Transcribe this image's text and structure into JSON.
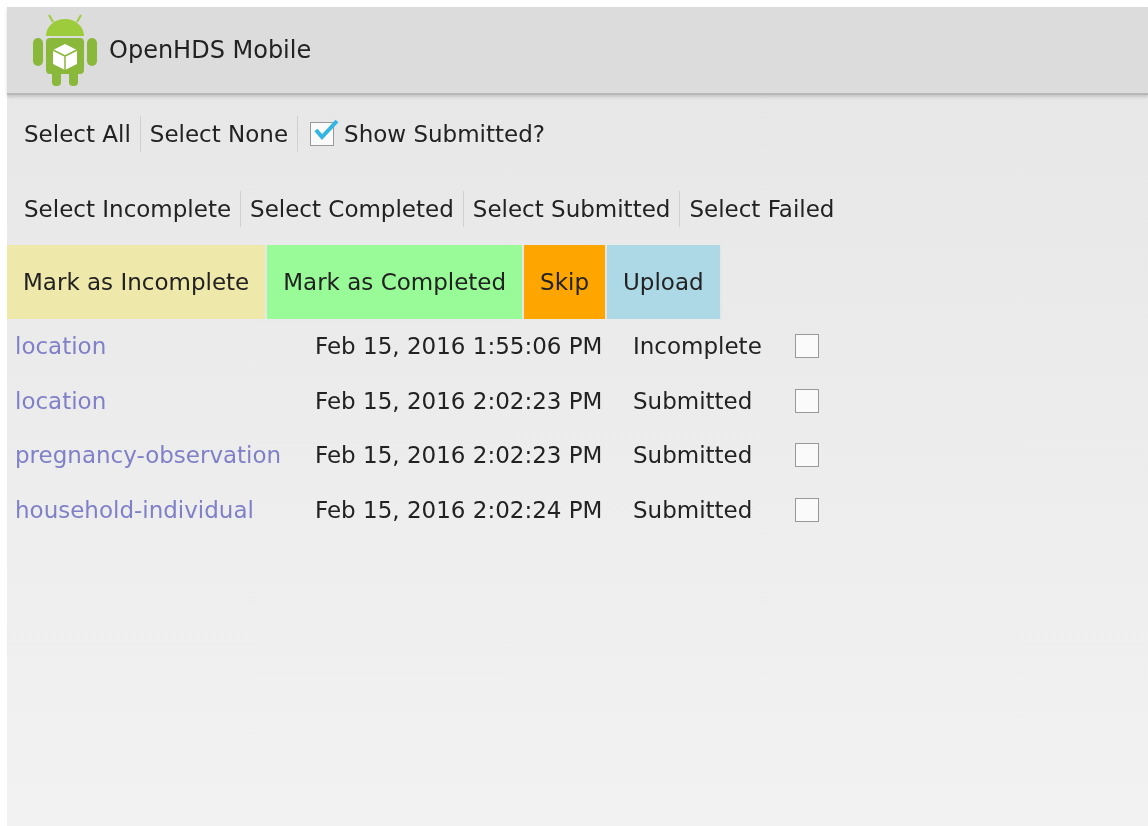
{
  "action_bar": {
    "title": "OpenHDS Mobile"
  },
  "toolbar_1": {
    "buttons": [
      "Select All",
      "Select None"
    ],
    "show_submitted": {
      "label": "Show Submitted?",
      "checked": true
    }
  },
  "toolbar_2": {
    "buttons": [
      "Select Incomplete",
      "Select Completed",
      "Select Submitted",
      "Select Failed"
    ]
  },
  "actions": [
    {
      "label": "Mark as Incomplete",
      "color": "#eee8aa"
    },
    {
      "label": "Mark as Completed",
      "color": "#98fb98"
    },
    {
      "label": "Skip",
      "color": "#ffa500"
    },
    {
      "label": "Upload",
      "color": "#add8e6"
    }
  ],
  "forms": [
    {
      "name": "location",
      "date": "Feb 15, 2016 1:55:06 PM",
      "status": "Incomplete",
      "checked": false
    },
    {
      "name": "location",
      "date": "Feb 15, 2016 2:02:23 PM",
      "status": "Submitted",
      "checked": false
    },
    {
      "name": "pregnancy-observation",
      "date": "Feb 15, 2016 2:02:23 PM",
      "status": "Submitted",
      "checked": false
    },
    {
      "name": "household-individual",
      "date": "Feb 15, 2016 2:02:24 PM",
      "status": "Submitted",
      "checked": false
    }
  ]
}
